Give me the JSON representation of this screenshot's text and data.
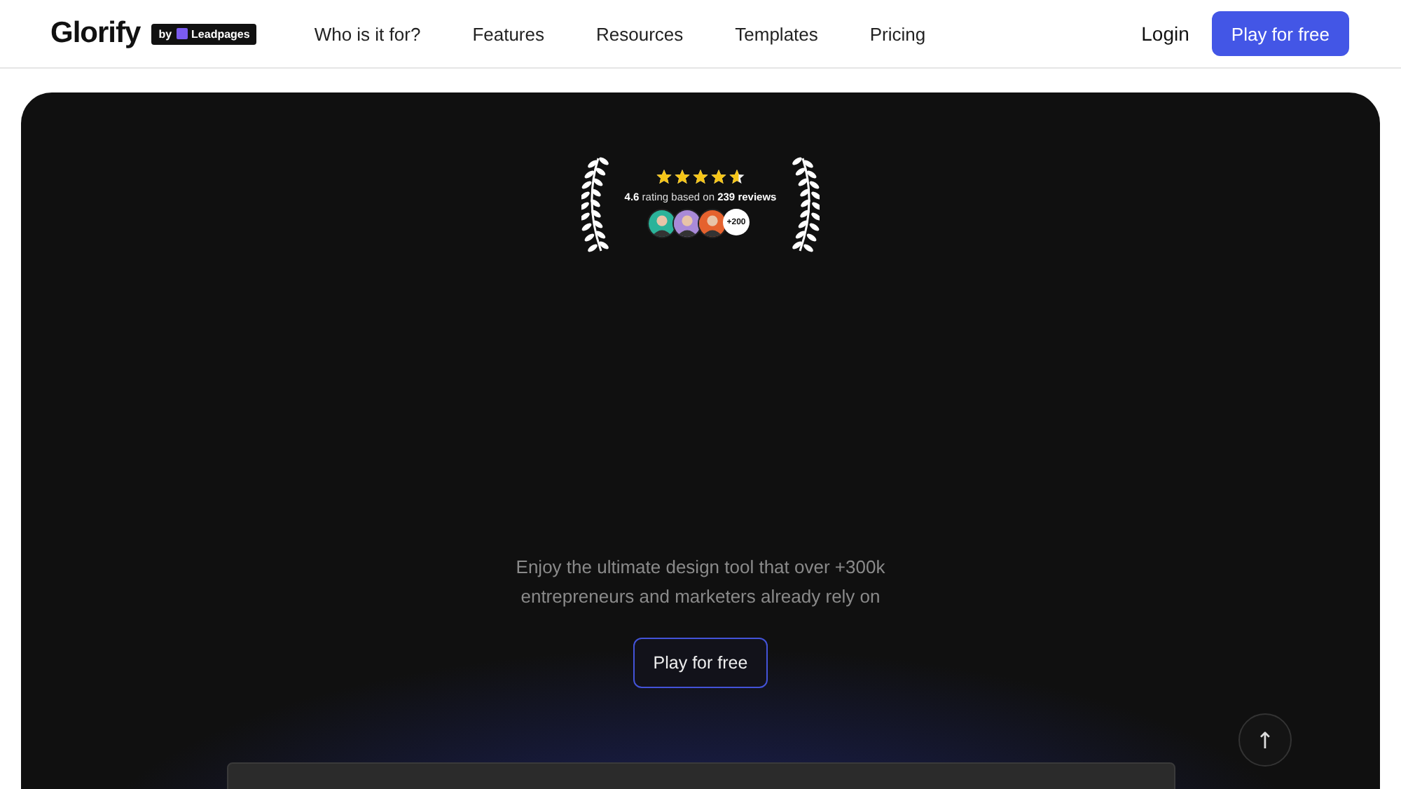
{
  "header": {
    "logo": "Glorify",
    "badge": {
      "prefix": "by",
      "name": "Leadpages"
    },
    "nav": [
      {
        "label": "Who is it for?"
      },
      {
        "label": "Features"
      },
      {
        "label": "Resources"
      },
      {
        "label": "Templates"
      },
      {
        "label": "Pricing"
      }
    ],
    "login": "Login",
    "cta": "Play for free"
  },
  "hero": {
    "rating": {
      "stars": 4.6,
      "text": "**4.6** rating based on **239 reviews**",
      "avatars": [
        {
          "color": "#2bb39a"
        },
        {
          "color": "#a98ad8"
        },
        {
          "color": "#e5622e"
        }
      ],
      "more": "+200"
    },
    "tagline": "Enjoy the ultimate design tool that over +300k entrepreneurs and marketers already rely on",
    "cta": "Play for free"
  },
  "scroll_top": {
    "label": "↑"
  }
}
